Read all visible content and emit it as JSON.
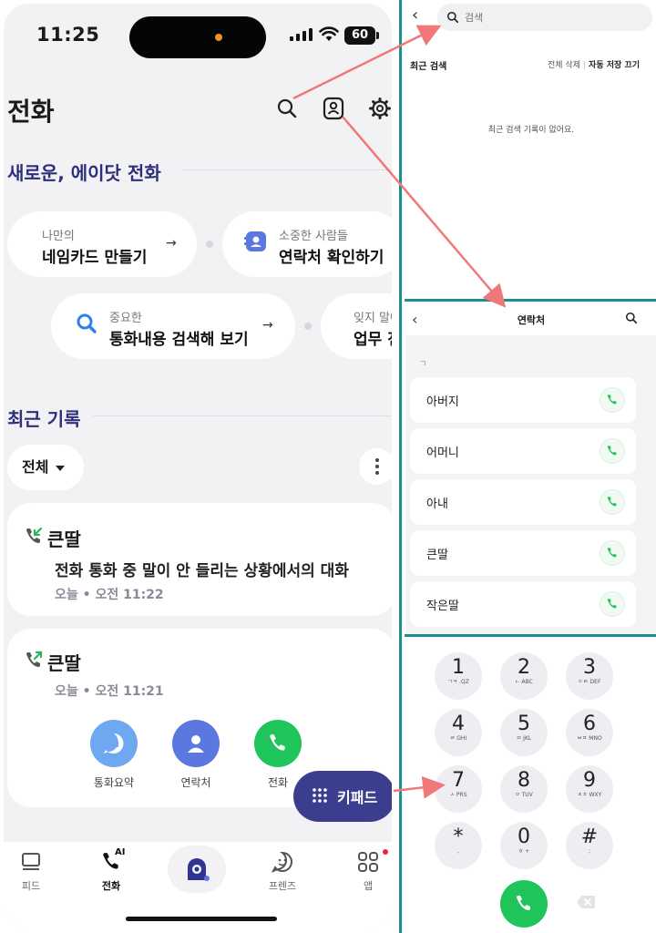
{
  "status": {
    "time": "11:25",
    "battery": "60"
  },
  "main": {
    "title": "전화",
    "intro_section": "새로운, 에이닷 전화",
    "pills": [
      {
        "sub": "나만의",
        "main": "네임카드 만들기"
      },
      {
        "sub": "소중한 사람들",
        "main": "연락처 확인하기"
      },
      {
        "sub": "중요한",
        "main": "통화내용 검색해 보기"
      },
      {
        "sub": "잊지 말아",
        "main": "업무 전"
      }
    ],
    "recent_section": "최근 기록",
    "filter": "전체",
    "cards": [
      {
        "name": "큰딸",
        "summary": "전화 통화 중 말이 안 들리는 상황에서의 대화",
        "time": "오늘 • 오전 11:22"
      },
      {
        "name": "큰딸",
        "time": "오늘 • 오전 11:21"
      }
    ],
    "actions": [
      "통화요약",
      "연락처",
      "전화"
    ],
    "keypad_button": "키패드",
    "tabs": [
      "피드",
      "전화",
      "",
      "프렌즈",
      "앱"
    ],
    "tab_ai_badge": "AI"
  },
  "search_panel": {
    "placeholder": "검색",
    "recent_label": "최근 검색",
    "delete_all": "전체 삭제",
    "auto_save_off": "자동 저장 끄기",
    "empty_message": "최근 검색 기록이 없어요."
  },
  "contacts_panel": {
    "title": "연락처",
    "index": "ㄱ",
    "contacts": [
      "아버지",
      "어머니",
      "아내",
      "큰딸",
      "작은딸"
    ]
  },
  "dialpad": {
    "keys": [
      {
        "digit": "1",
        "letters": "ㄱㅋ .QZ"
      },
      {
        "digit": "2",
        "letters": "ㄴ ABC"
      },
      {
        "digit": "3",
        "letters": "ㄷㅌ DEF"
      },
      {
        "digit": "4",
        "letters": "ㄹ GHI"
      },
      {
        "digit": "5",
        "letters": "ㅁ JKL"
      },
      {
        "digit": "6",
        "letters": "ㅂㅍ MNO"
      },
      {
        "digit": "7",
        "letters": "ㅅ PRS"
      },
      {
        "digit": "8",
        "letters": "ㅇ TUV"
      },
      {
        "digit": "9",
        "letters": "ㅈㅊ WXY"
      },
      {
        "digit": "*",
        "letters": ","
      },
      {
        "digit": "0",
        "letters": "ㅎ +"
      },
      {
        "digit": "#",
        "letters": ";"
      }
    ]
  },
  "colors": {
    "accent_navy": "#3b3d8f",
    "section_title": "#2d2f7a",
    "call_green": "#1fc45a",
    "summary_blue": "#6ea8f0",
    "contacts_blue": "#5a78e0",
    "divider_teal": "#1e8f8f",
    "arrow_red": "#f07878"
  }
}
